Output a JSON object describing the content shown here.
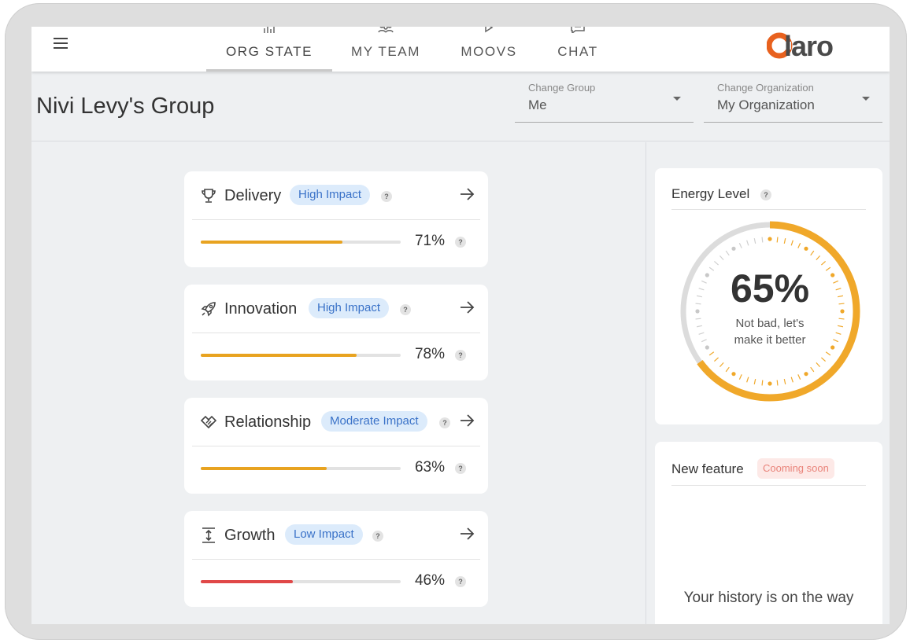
{
  "nav": {
    "tabs": [
      {
        "label": "ORG STATE",
        "icon": "chart-icon"
      },
      {
        "label": "MY TEAM",
        "icon": "team-icon"
      },
      {
        "label": "MOOVS",
        "icon": "play-icon"
      },
      {
        "label": "CHAT",
        "icon": "chat-icon"
      }
    ],
    "active": "ORG STATE",
    "logo": "claro"
  },
  "header": {
    "title": "Nivi Levy's Group",
    "group_select": {
      "label": "Change Group",
      "value": "Me"
    },
    "org_select": {
      "label": "Change Organization",
      "value": "My Organization"
    }
  },
  "metrics": [
    {
      "name": "Delivery",
      "icon": "trophy-icon",
      "impact": "High Impact",
      "percent": "71%",
      "value": 0.71,
      "color": "#e8a320"
    },
    {
      "name": "Innovation",
      "icon": "rocket-icon",
      "impact": "High Impact",
      "percent": "78%",
      "value": 0.78,
      "color": "#e8a320"
    },
    {
      "name": "Relationship",
      "icon": "handshake-icon",
      "impact": "Moderate Impact",
      "percent": "63%",
      "value": 0.63,
      "color": "#e8a320"
    },
    {
      "name": "Growth",
      "icon": "expand-vertical-icon",
      "impact": "Low Impact",
      "percent": "46%",
      "value": 0.46,
      "color": "#e04848"
    }
  ],
  "energy": {
    "title": "Energy Level",
    "percent": "65%",
    "value": 0.65,
    "message_line1": "Not bad, let's",
    "message_line2": "make it better",
    "color": "#f0a82a"
  },
  "feature": {
    "title": "New feature",
    "badge": "Cooming soon",
    "message": "Your history is on the way"
  },
  "help_mark": "?"
}
